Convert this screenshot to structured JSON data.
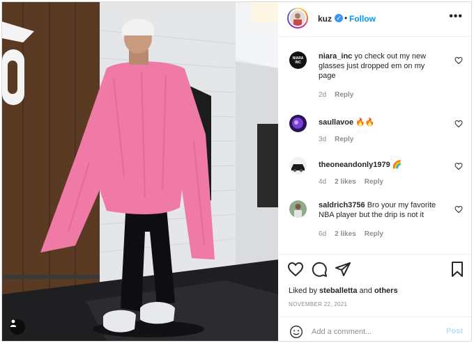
{
  "post": {
    "author": "kuz",
    "follow_label": "Follow",
    "separator": "•",
    "more_label": "•••",
    "verified_mark": "✓"
  },
  "comments": [
    {
      "user": "niara_inc",
      "text": "yo check out my new glasses just dropped em on my page",
      "time": "2d",
      "likes": "",
      "reply": "Reply",
      "avatar_icon": "niara-inc-logo-avatar"
    },
    {
      "user": "saullavoe",
      "text": "🔥🔥",
      "time": "3d",
      "likes": "",
      "reply": "Reply",
      "avatar_icon": "purple-neon-avatar"
    },
    {
      "user": "theoneandonly1979",
      "text": "🌈",
      "time": "4d",
      "likes": "2 likes",
      "reply": "Reply",
      "avatar_icon": "dark-car-avatar"
    },
    {
      "user": "saldrich3756",
      "text": "Bro your my favorite NBA player but the drip is not it",
      "time": "6d",
      "likes": "2 likes",
      "reply": "Reply",
      "avatar_icon": "person-outdoor-avatar"
    }
  ],
  "likes": {
    "prefix": "Liked by",
    "user": "steballetta",
    "conjunction": "and",
    "others": "others"
  },
  "date": "NOVEMBER 22, 2021",
  "add_comment": {
    "placeholder": "Add a comment...",
    "post_label": "Post"
  },
  "colors": {
    "accent": "#0095f6",
    "post_disabled": "#b2dffc",
    "muted": "#8e8e8e",
    "sweater": "#f07aa6"
  },
  "icons": [
    "heart-icon",
    "comment-icon",
    "share-icon",
    "bookmark-icon",
    "emoji-icon",
    "user-tag-icon",
    "verified-icon"
  ]
}
